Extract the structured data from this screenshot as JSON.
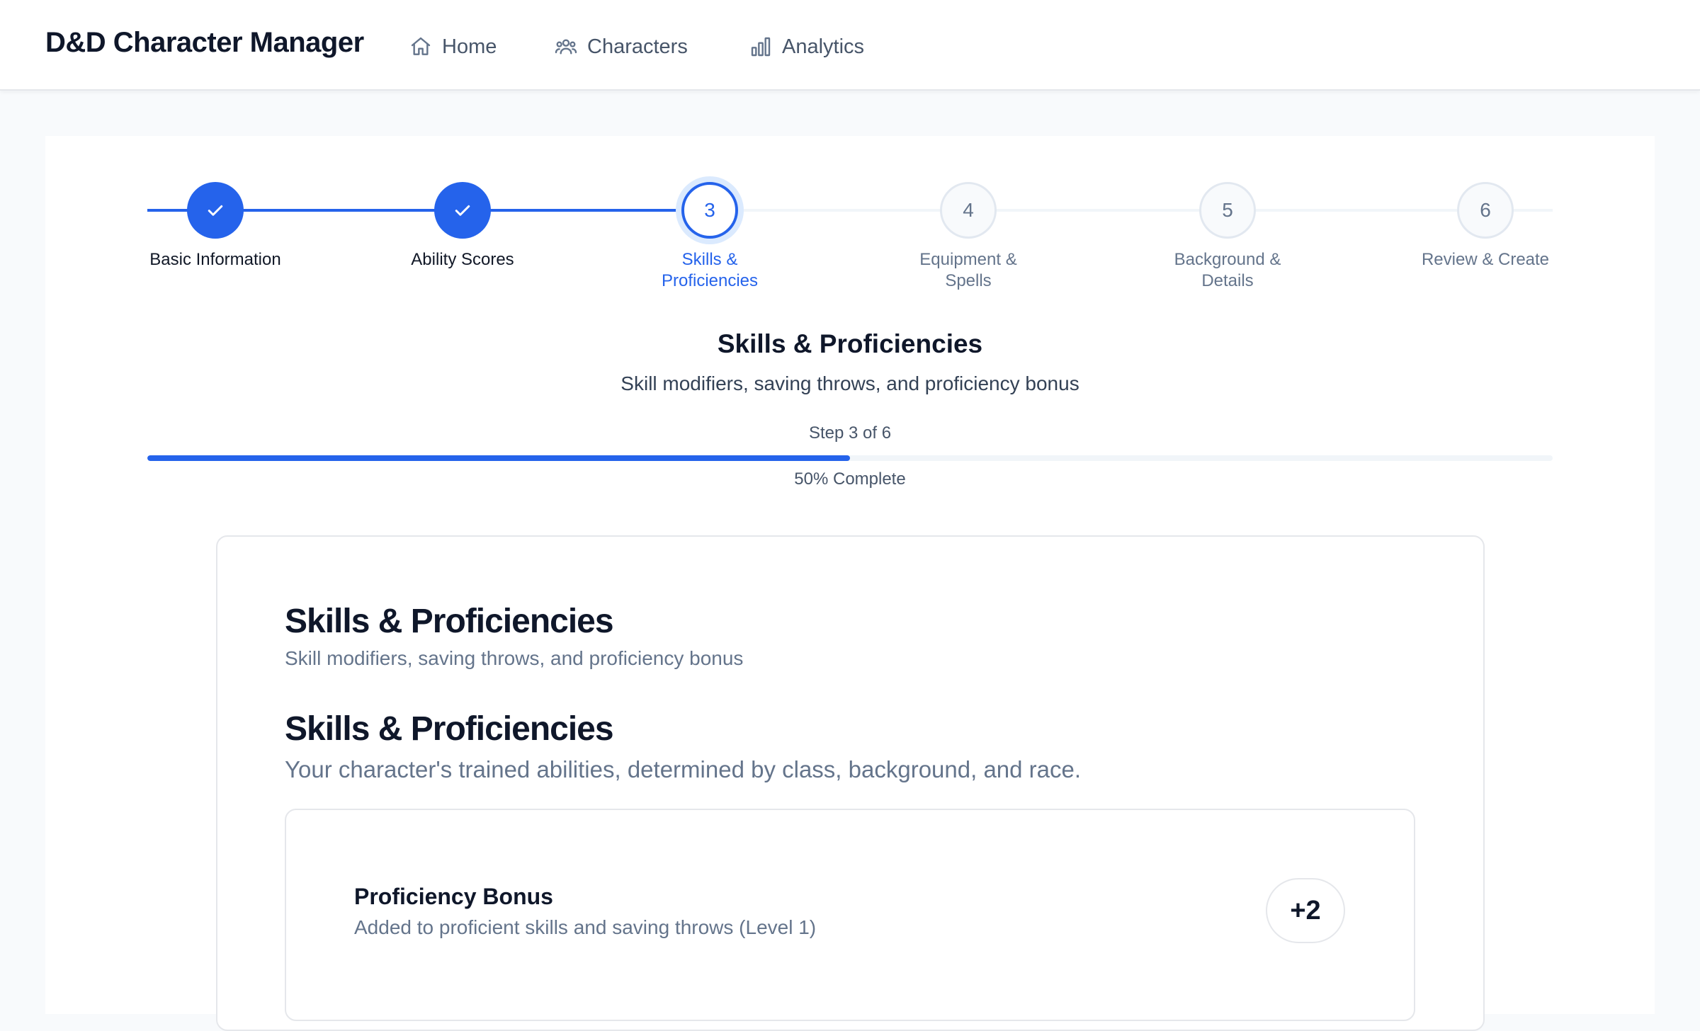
{
  "app": {
    "title": "D&D Character Manager"
  },
  "nav": {
    "items": [
      {
        "label": "Home",
        "icon": "home-icon"
      },
      {
        "label": "Characters",
        "icon": "users-icon"
      },
      {
        "label": "Analytics",
        "icon": "bar-chart-icon"
      }
    ]
  },
  "stepper": {
    "steps": [
      {
        "number": "1",
        "label": "Basic Information",
        "state": "completed"
      },
      {
        "number": "2",
        "label": "Ability Scores",
        "state": "completed"
      },
      {
        "number": "3",
        "label": "Skills & Proficiencies",
        "state": "current"
      },
      {
        "number": "4",
        "label": "Equipment & Spells",
        "state": "upcoming"
      },
      {
        "number": "5",
        "label": "Background & Details",
        "state": "upcoming"
      },
      {
        "number": "6",
        "label": "Review & Create",
        "state": "upcoming"
      }
    ],
    "current_title": "Skills & Proficiencies",
    "current_subtitle": "Skill modifiers, saving throws, and proficiency bonus",
    "counter": "Step 3 of 6",
    "progress_percent": 50,
    "progress_text": "50% Complete"
  },
  "content": {
    "card_title": "Skills & Proficiencies",
    "card_description": "Skill modifiers, saving throws, and proficiency bonus",
    "section_title": "Skills & Proficiencies",
    "section_description": "Your character's trained abilities, determined by class, background, and race.",
    "proficiency": {
      "title": "Proficiency Bonus",
      "description": "Added to proficient skills and saving throws (Level 1)",
      "value": "+2"
    }
  },
  "colors": {
    "accent": "#2563eb",
    "accent_soft": "#dbeafe",
    "text": "#0f172a",
    "muted": "#64748b",
    "border": "#e5e7eb"
  }
}
